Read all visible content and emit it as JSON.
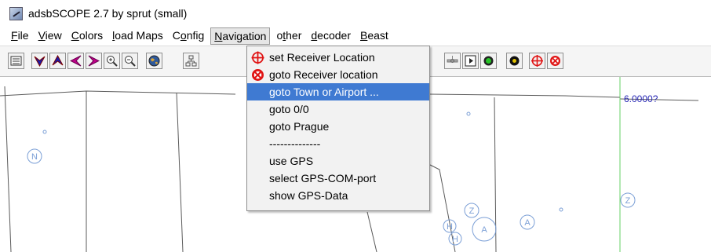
{
  "window": {
    "title": "adsbSCOPE 2.7 by sprut  (small)"
  },
  "menubar": {
    "items": [
      {
        "pre": "",
        "ul": "F",
        "post": "ile"
      },
      {
        "pre": "",
        "ul": "V",
        "post": "iew"
      },
      {
        "pre": "",
        "ul": "C",
        "post": "olors"
      },
      {
        "pre": "",
        "ul": "l",
        "post": "oad Maps"
      },
      {
        "pre": "C",
        "ul": "o",
        "post": "nfig"
      },
      {
        "pre": "",
        "ul": "N",
        "post": "avigation"
      },
      {
        "pre": "o",
        "ul": "t",
        "post": "her"
      },
      {
        "pre": "",
        "ul": "d",
        "post": "ecoder"
      },
      {
        "pre": "",
        "ul": "B",
        "post": "east"
      }
    ]
  },
  "toolbar": {
    "buttons": [
      "list-icon",
      "arrow-down-icon",
      "arrow-up-icon",
      "arrow-left-icon",
      "arrow-right-icon",
      "zoom-in-icon",
      "zoom-out-icon",
      "globe-icon",
      "network-icon",
      "satellite-icon",
      "play-icon",
      "green-dot-icon",
      "black-dot-icon",
      "crosshair-icon",
      "target-icon"
    ]
  },
  "navigation_menu": {
    "items": [
      {
        "label": "set Receiver Location",
        "icon": "crosshair-icon"
      },
      {
        "label": "goto Receiver location",
        "icon": "target-icon"
      },
      {
        "label": "goto Town or Airport ...",
        "selected": true
      },
      {
        "label": "goto 0/0"
      },
      {
        "label": "goto Prague"
      },
      {
        "label": "--------------"
      },
      {
        "label": "use GPS"
      },
      {
        "label": "select GPS-COM-port"
      },
      {
        "label": "show GPS-Data"
      }
    ]
  },
  "map": {
    "scale_label": "6.0000?",
    "markers": [
      "N",
      "Z",
      "Z",
      "A",
      "A",
      "H",
      "H"
    ]
  },
  "colors": {
    "selection": "#3f7ad2",
    "map_line": "#5b5b5b",
    "marker": "#7b9fd6",
    "grid": "#66d066",
    "red_icon": "#e01414"
  }
}
